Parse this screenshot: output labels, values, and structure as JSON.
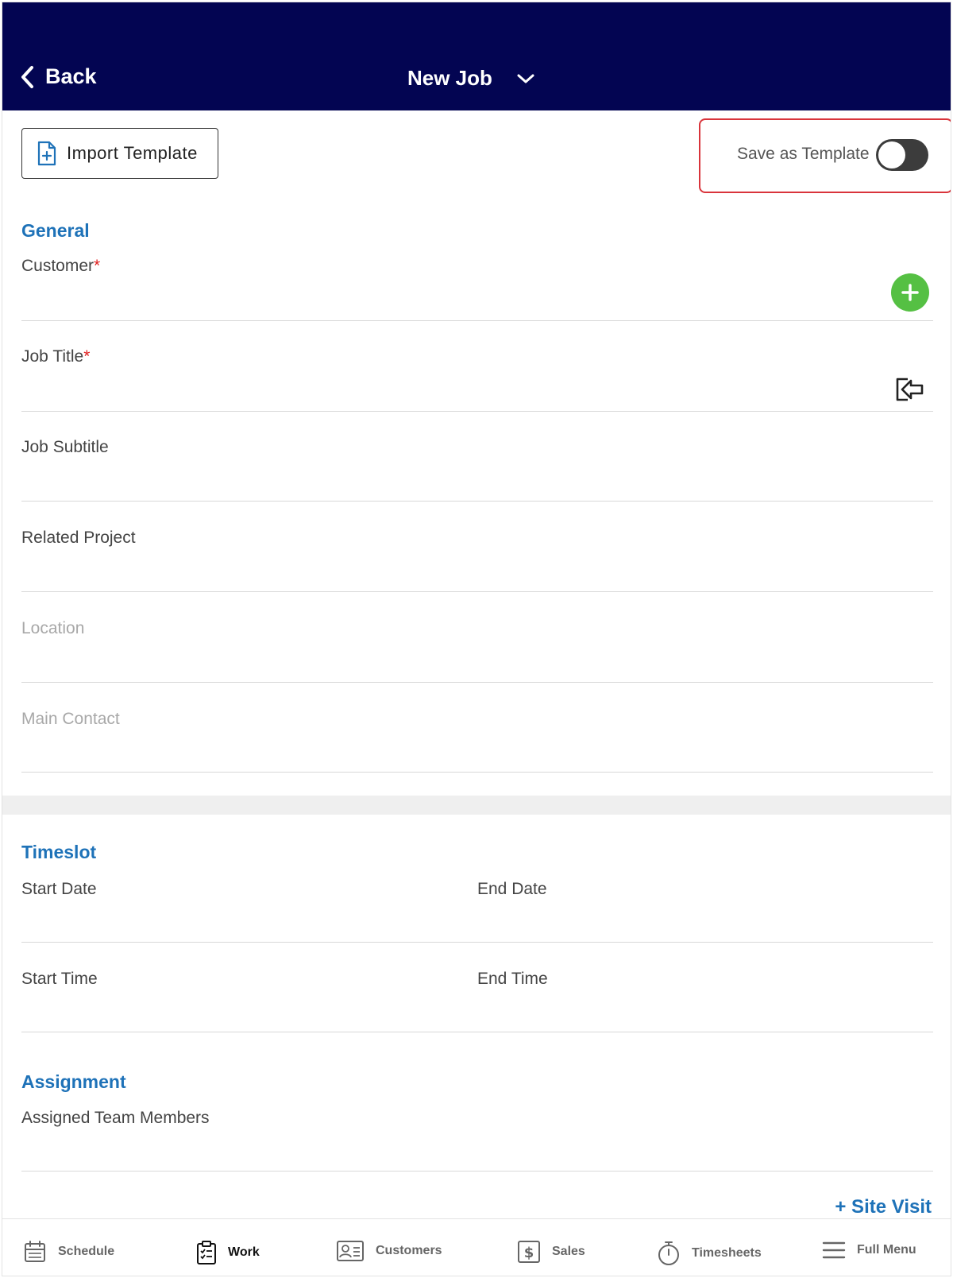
{
  "header": {
    "back_label": "Back",
    "title": "New Job"
  },
  "toolbar": {
    "import_template_label": "Import Template",
    "save_as_template_label": "Save as Template",
    "save_as_template_enabled": false
  },
  "general": {
    "section_title": "General",
    "customer_label": "Customer",
    "job_title_label": "Job Title",
    "required_mark": "*",
    "job_subtitle_label": "Job Subtitle",
    "related_project_label": "Related Project",
    "location_label": "Location",
    "main_contact_label": "Main Contact"
  },
  "timeslot": {
    "section_title": "Timeslot",
    "start_date_label": "Start Date",
    "end_date_label": "End Date",
    "start_time_label": "Start Time",
    "end_time_label": "End Time"
  },
  "assignment": {
    "section_title": "Assignment",
    "assigned_team_label": "Assigned Team Members",
    "site_visit_label": "+ Site Visit"
  },
  "bottom_nav": {
    "schedule": "Schedule",
    "work": "Work",
    "customers": "Customers",
    "sales": "Sales",
    "timesheets": "Timesheets",
    "full_menu": "Full Menu",
    "active": "work"
  },
  "colors": {
    "header_bg": "#030552",
    "accent_blue": "#1e72b8",
    "add_green": "#55c043",
    "highlight_red": "#d9343b",
    "required_red": "#e02020"
  },
  "icons": {
    "back": "chevron-left-icon",
    "title_dropdown": "chevron-down-icon",
    "import_template": "document-plus-icon",
    "add_customer": "plus-circle-icon",
    "import_title": "import-arrow-icon"
  }
}
